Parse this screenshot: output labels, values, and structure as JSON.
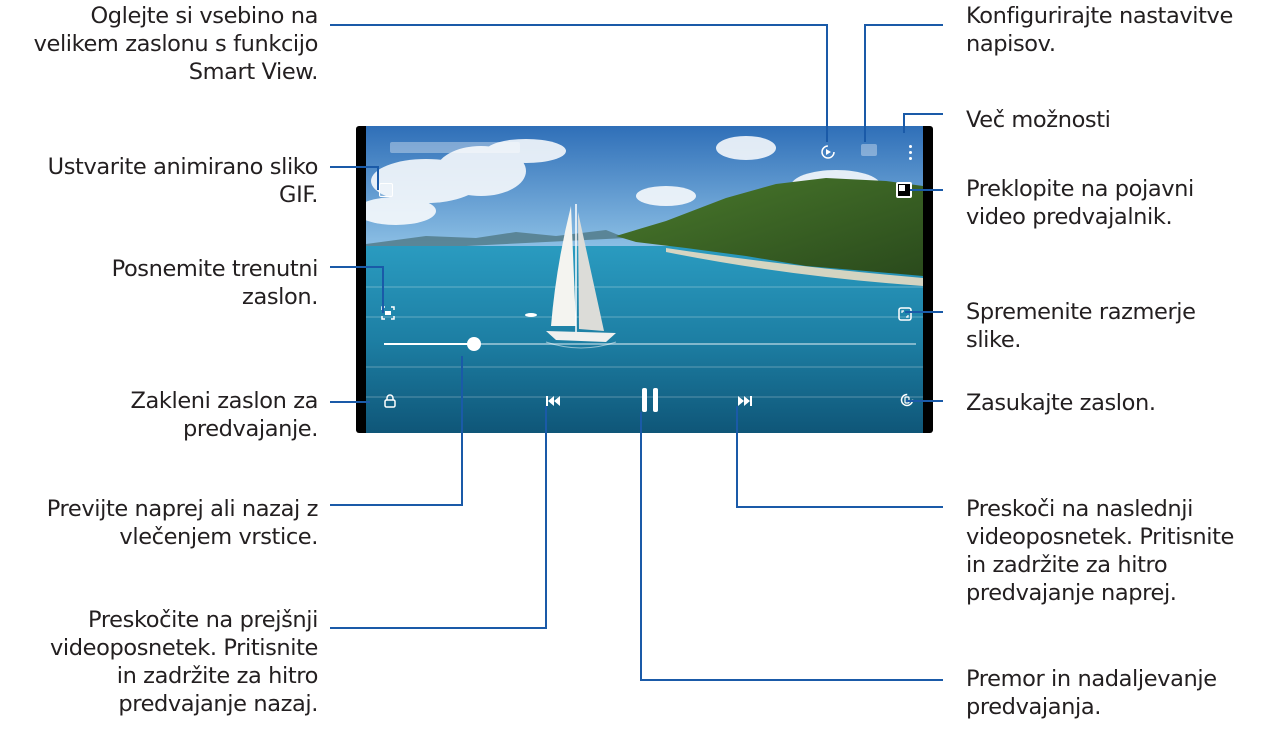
{
  "annotations": {
    "smart_view": "Oglejte si vsebino na\nvelikem zaslonu s funkcijo\nSmart View.",
    "gif": "Ustvarite animirano sliko\nGIF.",
    "capture": "Posnemite trenutni\nzaslon.",
    "lock": "Zakleni zaslon za\npredvajanje.",
    "seek": "Previjte naprej ali nazaj z\nvlečenjem vrstice.",
    "previous": "Preskočite na prejšnji\nvideoposnetek. Pritisnite\nin zadržite za hitro\npredvajanje nazaj.",
    "subtitles": "Konfigurirajte nastavitve\nnapisov.",
    "more": "Več možnosti",
    "popup": "Preklopite na pojavni\nvideo predvajalnik.",
    "ratio": "Spremenite razmerje\nslike.",
    "rotate": "Zasukajte zaslon.",
    "next": "Preskoči na naslednji\nvideoposnetek. Pritisnite\nin zadržite za hitro\npredvajanje naprej.",
    "pause": "Premor in nadaljevanje\npredvajanja."
  },
  "player": {
    "progress": 0.17,
    "icons": {
      "smart_view": "smart-view-icon",
      "subtitles": "subtitles-icon",
      "more": "more-options-icon",
      "gif": "gif-icon",
      "popup": "popup-player-icon",
      "capture": "capture-icon",
      "ratio": "ratio-icon",
      "lock": "lock-icon",
      "previous": "previous-icon",
      "pause": "pause-icon",
      "next": "next-icon",
      "rotate": "rotate-icon"
    }
  },
  "colors": {
    "text": "#231f20",
    "leader_line": "#1a5aa8",
    "sky": "#3a7ac0",
    "sea": "#1e88a8",
    "island": "#3f6b2a"
  }
}
